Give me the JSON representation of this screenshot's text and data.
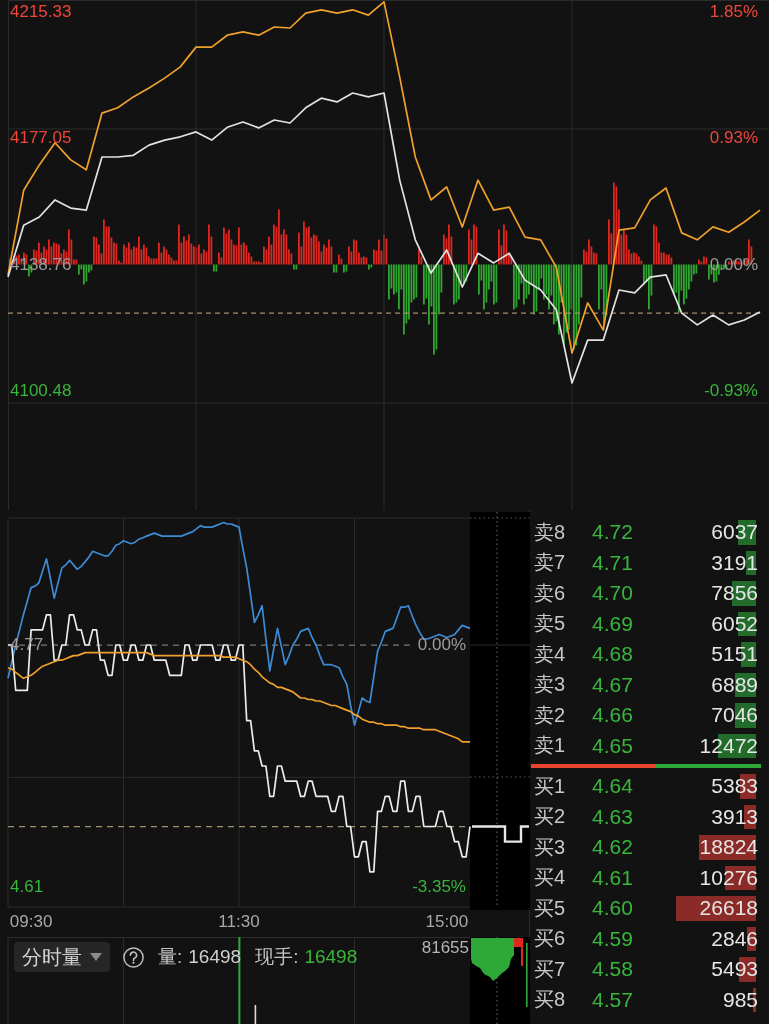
{
  "index_chart": {
    "chart_data": {
      "type": "line",
      "grid": true,
      "ylim": [
        4064.42,
        4218.97
      ],
      "y2lim": [
        -1.8,
        1.94
      ],
      "yticks": [
        {
          "value": 4215.33,
          "label": "4215.33"
        },
        {
          "value": 4177.05,
          "label": "4177.05"
        },
        {
          "value": 4138.76,
          "label": "4138.76"
        },
        {
          "value": 4100.48,
          "label": "4100.48"
        }
      ],
      "y2ticks": [
        {
          "value": 1.85,
          "label": "1.85%"
        },
        {
          "value": 0.93,
          "label": "0.93%"
        },
        {
          "value": 0,
          "label": "0.00%"
        },
        {
          "value": -0.93,
          "label": "-0.93%"
        }
      ],
      "series": [
        {
          "color": "#f0a02c",
          "values": [
            4135.7,
            4161.3,
            4169.0,
            4175.7,
            4170.5,
            4167.5,
            4184.7,
            4186.3,
            4189.6,
            4192.3,
            4195.3,
            4198.7,
            4204.7,
            4204.7,
            4208.3,
            4209.3,
            4208.3,
            4210.8,
            4210.5,
            4215.0,
            4216.0,
            4215.0,
            4216.0,
            4214.4,
            4218.4,
            4195.6,
            4171.4,
            4158.4,
            4162.3,
            4150.2,
            4164.4,
            4155.3,
            4156.2,
            4147.1,
            4146.3,
            4138.0,
            4112.0,
            4127.2,
            4118.9,
            4149.2,
            4149.9,
            4158.4,
            4162.0,
            4148.4,
            4146.3,
            4150.2,
            4148.6,
            4151.7,
            4155.3
          ]
        },
        {
          "color": "#e2e2e2",
          "values": [
            4135.0,
            4150.7,
            4153.2,
            4158.4,
            4155.9,
            4155.3,
            4171.4,
            4171.4,
            4171.9,
            4175.0,
            4176.5,
            4177.5,
            4179.0,
            4176.5,
            4180.4,
            4182.0,
            4180.2,
            4182.6,
            4181.7,
            4186.3,
            4189.2,
            4188.1,
            4190.8,
            4189.6,
            4190.8,
            4164.4,
            4146.3,
            4136.2,
            4143.2,
            4132.0,
            4142.2,
            4139.3,
            4142.2,
            4134.1,
            4131.1,
            4125.1,
            4102.9,
            4115.9,
            4115.9,
            4131.1,
            4130.2,
            4135.0,
            4135.7,
            4124.1,
            4120.5,
            4123.5,
            4120.5,
            4122.0,
            4124.4
          ]
        }
      ],
      "ref_lines": [
        {
          "axis": "y",
          "value": 4124.1,
          "color": "#a58e6c"
        }
      ]
    }
  },
  "stock_chart": {
    "chart_data": {
      "type": "line",
      "grid": true,
      "categories": [
        null,
        null,
        null,
        null,
        null,
        null,
        "09:30",
        null,
        null,
        null,
        null,
        null,
        null,
        null,
        null,
        null,
        null,
        null,
        null,
        null,
        null,
        null,
        null,
        null,
        null,
        null,
        null,
        null,
        null,
        null,
        null,
        null,
        null,
        null,
        null,
        null,
        null,
        null,
        null,
        null,
        null,
        null,
        null,
        null,
        null,
        null,
        null,
        null,
        null,
        null,
        null,
        null,
        null,
        null,
        null,
        null,
        null,
        null,
        null,
        null,
        "11:30",
        null,
        null,
        null,
        null,
        null,
        null,
        null,
        null,
        null,
        null,
        null,
        null,
        null,
        null,
        null,
        null,
        null,
        null,
        null,
        null,
        null,
        null,
        null,
        null,
        null,
        null,
        null,
        null,
        null,
        null,
        null,
        null,
        null,
        null,
        null,
        null,
        null,
        null,
        null,
        null,
        null,
        null,
        null,
        null,
        null,
        null,
        null,
        null,
        null,
        null,
        null,
        null,
        null,
        "15:00",
        null,
        null,
        null,
        null,
        null,
        null
      ],
      "ylim": [
        4.5968,
        4.854
      ],
      "y2lim": [
        -3.627,
        1.758
      ],
      "yticks": [
        {
          "value": 4.77,
          "label": "4.77"
        },
        {
          "value": 4.61,
          "label": "4.61"
        }
      ],
      "y2ticks": [
        {
          "value": 0,
          "label": "0.00%"
        },
        {
          "value": -3.35,
          "label": "-3.35%"
        }
      ],
      "series": [
        {
          "color": "#3d8bd4",
          "values": [
            4.748,
            4.759,
            4.77,
            4.78,
            4.79,
            4.799,
            4.808,
            4.809,
            4.811,
            4.819,
            4.827,
            4.814,
            4.801,
            4.811,
            4.821,
            4.823,
            4.826,
            4.823,
            4.82,
            4.822,
            4.825,
            4.828,
            4.832,
            4.831,
            4.83,
            4.829,
            4.829,
            4.832,
            4.836,
            4.837,
            4.839,
            4.838,
            4.837,
            4.838,
            4.84,
            4.841,
            4.842,
            4.843,
            4.844,
            4.843,
            4.842,
            4.842,
            4.842,
            4.842,
            4.842,
            4.842,
            4.843,
            4.844,
            4.845,
            4.847,
            4.849,
            4.848,
            4.848,
            4.848,
            4.849,
            4.85,
            4.851,
            4.85,
            4.85,
            4.849,
            4.848,
            4.834,
            4.821,
            4.803,
            4.785,
            4.79,
            4.796,
            4.774,
            4.753,
            4.767,
            4.781,
            4.769,
            4.757,
            4.763,
            4.77,
            4.774,
            4.779,
            4.78,
            4.781,
            4.775,
            4.77,
            4.763,
            4.757,
            4.757,
            4.757,
            4.756,
            4.755,
            4.749,
            4.744,
            4.73,
            4.717,
            4.726,
            4.735,
            4.733,
            4.732,
            4.749,
            4.766,
            4.772,
            4.779,
            4.78,
            4.781,
            4.788,
            4.795,
            4.795,
            4.796,
            4.789,
            4.783,
            4.778,
            4.774,
            4.774,
            4.775,
            4.776,
            4.777,
            4.776,
            4.775,
            4.776,
            4.777,
            4.78,
            4.783,
            4.782,
            4.781
          ]
        },
        {
          "color": "#ececec",
          "values": [
            4.77,
            4.77,
            4.74,
            4.74,
            4.74,
            4.74,
            4.78,
            4.78,
            4.78,
            4.78,
            4.79,
            4.79,
            4.76,
            4.76,
            4.77,
            4.77,
            4.79,
            4.79,
            4.78,
            4.78,
            4.77,
            4.77,
            4.78,
            4.78,
            4.76,
            4.76,
            4.75,
            4.75,
            4.77,
            4.77,
            4.76,
            4.76,
            4.77,
            4.77,
            4.76,
            4.76,
            4.77,
            4.77,
            4.76,
            4.76,
            4.76,
            4.76,
            4.75,
            4.75,
            4.75,
            4.75,
            4.77,
            4.77,
            4.76,
            4.76,
            4.77,
            4.77,
            4.77,
            4.77,
            4.76,
            4.76,
            4.77,
            4.77,
            4.76,
            4.76,
            4.77,
            4.77,
            4.72,
            4.72,
            4.7,
            4.7,
            4.69,
            4.69,
            4.67,
            4.67,
            4.69,
            4.69,
            4.68,
            4.68,
            4.68,
            4.68,
            4.67,
            4.67,
            4.68,
            4.68,
            4.67,
            4.67,
            4.67,
            4.67,
            4.66,
            4.66,
            4.67,
            4.67,
            4.65,
            4.65,
            4.63,
            4.63,
            4.64,
            4.64,
            4.62,
            4.62,
            4.66,
            4.66,
            4.67,
            4.67,
            4.66,
            4.66,
            4.68,
            4.68,
            4.66,
            4.66,
            4.67,
            4.67,
            4.65,
            4.65,
            4.65,
            4.65,
            4.66,
            4.66,
            4.65,
            4.65,
            4.64,
            4.64,
            4.63,
            4.63,
            4.65
          ]
        },
        {
          "color": "#f0a02c",
          "values": [
            4.755,
            4.754,
            4.752,
            4.75,
            4.748,
            4.749,
            4.75,
            4.752,
            4.754,
            4.756,
            4.757,
            4.758,
            4.759,
            4.76,
            4.76,
            4.761,
            4.762,
            4.763,
            4.763,
            4.764,
            4.765,
            4.765,
            4.765,
            4.765,
            4.765,
            4.765,
            4.765,
            4.765,
            4.765,
            4.765,
            4.765,
            4.765,
            4.765,
            4.765,
            4.765,
            4.765,
            4.765,
            4.764,
            4.763,
            4.763,
            4.763,
            4.763,
            4.763,
            4.763,
            4.763,
            4.763,
            4.763,
            4.763,
            4.763,
            4.763,
            4.763,
            4.763,
            4.763,
            4.763,
            4.763,
            4.763,
            4.762,
            4.762,
            4.762,
            4.762,
            4.761,
            4.76,
            4.759,
            4.757,
            4.754,
            4.752,
            4.749,
            4.747,
            4.745,
            4.744,
            4.742,
            4.742,
            4.741,
            4.74,
            4.739,
            4.737,
            4.735,
            4.735,
            4.734,
            4.734,
            4.733,
            4.733,
            4.732,
            4.731,
            4.73,
            4.73,
            4.729,
            4.728,
            4.727,
            4.726,
            4.724,
            4.723,
            4.721,
            4.72,
            4.719,
            4.719,
            4.718,
            4.718,
            4.717,
            4.717,
            4.717,
            4.717,
            4.716,
            4.716,
            4.715,
            4.715,
            4.715,
            4.715,
            4.714,
            4.714,
            4.714,
            4.714,
            4.713,
            4.712,
            4.711,
            4.71,
            4.709,
            4.708,
            4.706,
            4.706,
            4.706
          ]
        }
      ],
      "ref_lines": [
        {
          "axis": "y",
          "value": 4.77,
          "color": "#7a7a7a"
        },
        {
          "axis": "y",
          "value": 4.65,
          "color": "#a58e6c"
        }
      ]
    }
  },
  "volume_panel": {
    "mode_button": {
      "label": "分时量"
    },
    "stats": [
      {
        "label": "量:",
        "value": "16498",
        "falling": false
      },
      {
        "label": "现手:",
        "value": "16498",
        "falling": true
      }
    ],
    "max_label": "81655"
  },
  "order_book": {
    "asks": [
      {
        "label": "卖8",
        "price": "4.72",
        "volume": "6037",
        "level": 0.23
      },
      {
        "label": "卖7",
        "price": "4.71",
        "volume": "3191",
        "level": 0.12
      },
      {
        "label": "卖6",
        "price": "4.70",
        "volume": "7856",
        "level": 0.3
      },
      {
        "label": "卖5",
        "price": "4.69",
        "volume": "6052",
        "level": 0.23
      },
      {
        "label": "卖4",
        "price": "4.68",
        "volume": "5151",
        "level": 0.19
      },
      {
        "label": "卖3",
        "price": "4.67",
        "volume": "6889",
        "level": 0.26
      },
      {
        "label": "卖2",
        "price": "4.66",
        "volume": "7046",
        "level": 0.26
      },
      {
        "label": "卖1",
        "price": "4.65",
        "volume": "12472",
        "level": 0.47
      }
    ],
    "ratio_bar": {
      "level": 0.54
    },
    "bids": [
      {
        "label": "买1",
        "price": "4.64",
        "volume": "5383",
        "level": 0.2
      },
      {
        "label": "买2",
        "price": "4.63",
        "volume": "3913",
        "level": 0.15
      },
      {
        "label": "买3",
        "price": "4.62",
        "volume": "18824",
        "level": 0.71
      },
      {
        "label": "买4",
        "price": "4.61",
        "volume": "10276",
        "level": 0.39
      },
      {
        "label": "买5",
        "price": "4.60",
        "volume": "26618",
        "level": 1.0
      },
      {
        "label": "买6",
        "price": "4.59",
        "volume": "2846",
        "level": 0.11
      },
      {
        "label": "买7",
        "price": "4.58",
        "volume": "5493",
        "level": 0.21
      },
      {
        "label": "买8",
        "price": "4.57",
        "volume": "985",
        "level": 0.04
      }
    ]
  }
}
